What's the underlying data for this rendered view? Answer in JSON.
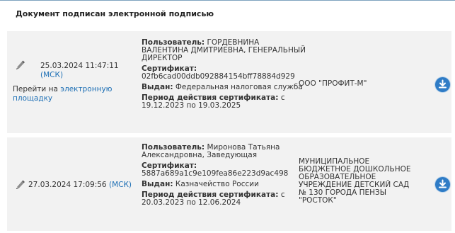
{
  "header": {
    "title": "Документ подписан электронной подписью"
  },
  "records": [
    {
      "date": "25.03.2024 11:47:11",
      "tz": "(МСК)",
      "link_prefix": "Перейти на",
      "link_text": "электронную площадку",
      "user_label": "Пользователь:",
      "user_value": "ГОРДЕВНИНА ВАЛЕНТИНА ДМИТРИЕВНА, ГЕНЕРАЛЬНЫЙ ДИРЕКТОР",
      "cert_label": "Сертификат:",
      "cert_value": "02fb6cad00ddb092884154bff78884d929",
      "issued_label": "Выдан:",
      "issued_value": "Федеральная налоговая служба",
      "period_label": "Период действия сертификата:",
      "period_value": "с 19.12.2023 по 19.03.2025",
      "organization": "ООО \"ПРОФИТ-М\""
    },
    {
      "date": "27.03.2024 17:09:56",
      "tz": "(МСК)",
      "user_label": "Пользователь:",
      "user_value": "Миронова Татьяна Александровна, Заведующая",
      "cert_label": "Сертификат:",
      "cert_value": "5887a689a1c9e109fea86e223d9ac498",
      "issued_label": "Выдан:",
      "issued_value": "Казначейство России",
      "period_label": "Период действия сертификата:",
      "period_value": "с 20.03.2023 по 12.06.2024",
      "organization": "МУНИЦИПАЛЬНОЕ БЮДЖЕТНОЕ ДОШКОЛЬНОЕ ОБРАЗОВАТЕЛЬНОЕ УЧРЕЖДЕНИЕ ДЕТСКИЙ САД № 130 ГОРОДА ПЕНЗЫ \"РОСТОК\""
    }
  ],
  "icons": {
    "signature": "pen-signature-icon",
    "download": "download-icon"
  },
  "colors": {
    "accent": "#2f7cc6",
    "link": "#1d6fb5",
    "row_bg": "#f2f2f2"
  }
}
